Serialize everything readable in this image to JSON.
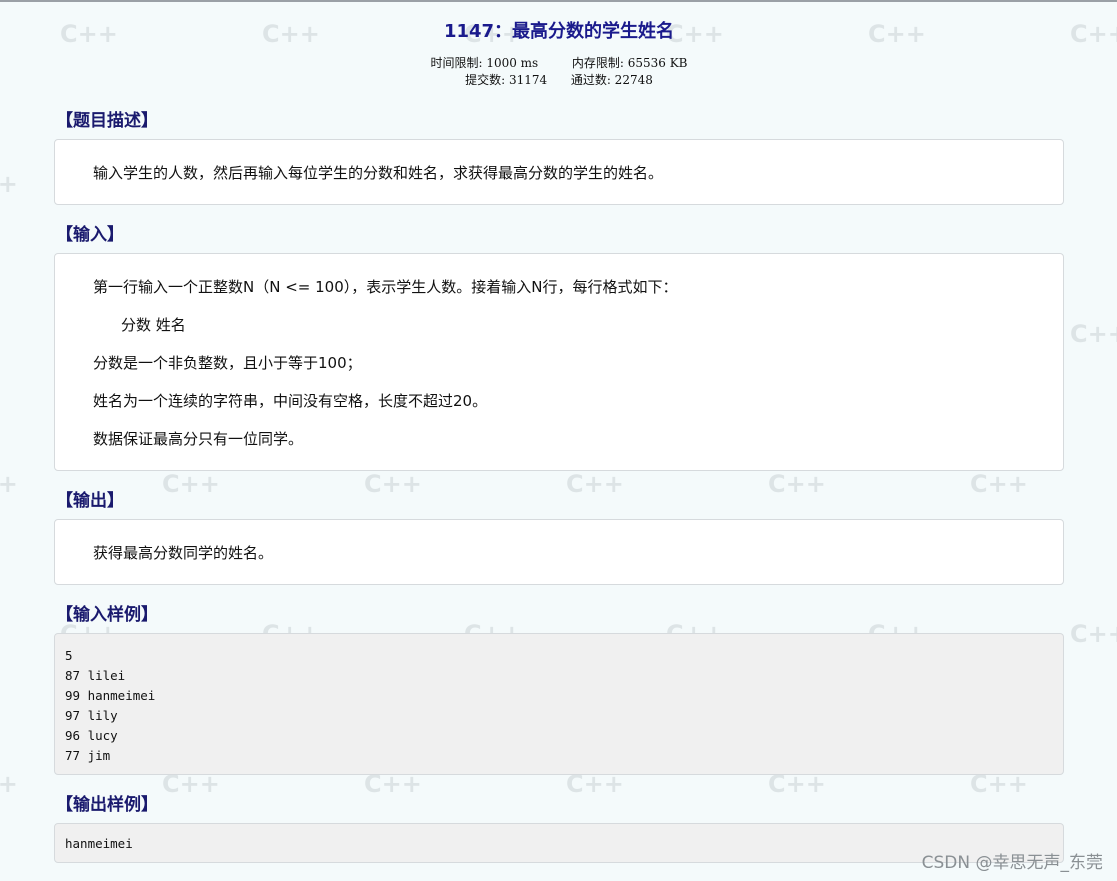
{
  "problem": {
    "title": "1147：最高分数的学生姓名",
    "time_limit_label": "时间限制: 1000 ms",
    "memory_limit_label": "内存限制: 65536 KB",
    "submissions_label": "提交数: 31174",
    "accepted_label": "通过数: 22748"
  },
  "sections": {
    "description": {
      "heading": "【题目描述】",
      "text": "输入学生的人数，然后再输入每位学生的分数和姓名，求获得最高分数的学生的姓名。"
    },
    "input": {
      "heading": "【输入】",
      "lines": [
        "第一行输入一个正整数N（N <= 100），表示学生人数。接着输入N行，每行格式如下：",
        "分数 姓名",
        "分数是一个非负整数，且小于等于100；",
        "姓名为一个连续的字符串，中间没有空格，长度不超过20。",
        "数据保证最高分只有一位同学。"
      ]
    },
    "output": {
      "heading": "【输出】",
      "text": "获得最高分数同学的姓名。"
    },
    "sample_input": {
      "heading": "【输入样例】",
      "lines": [
        "5",
        "87 lilei",
        "99 hanmeimei",
        "97 lily",
        "96 lucy",
        "77 jim"
      ]
    },
    "sample_output": {
      "heading": "【输出样例】",
      "lines": [
        "hanmeimei"
      ]
    }
  },
  "watermark": {
    "csdn": "CSDN @幸思无声_东莞"
  },
  "colors": {
    "heading": "#1a1a6e",
    "title": "#1a1a8c",
    "background": "#f4fafb",
    "code_background": "#f0f0f0"
  }
}
